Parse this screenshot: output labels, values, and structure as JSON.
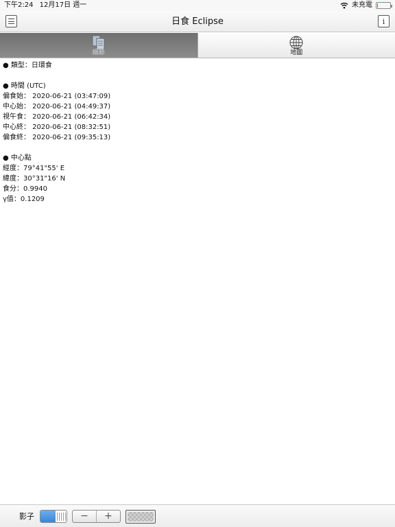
{
  "status_bar": {
    "time": "下午2:24",
    "date": "12月17日 週一",
    "charging": "未充電",
    "battery_level": 0.05
  },
  "nav": {
    "title": "日食 Eclipse",
    "left_icon": "menu-icon",
    "right_icon": "info-icon"
  },
  "tabs": [
    {
      "label": "細節",
      "icon": "documents-icon",
      "selected": true
    },
    {
      "label": "地圖",
      "icon": "globe-icon",
      "selected": false
    }
  ],
  "details": {
    "type_line": "● 類型：日環食",
    "times_header": "● 時間 (UTC)",
    "times": [
      "偏食始： 2020-06-21 (03:47:09)",
      "中心始： 2020-06-21 (04:49:37)",
      "視午食： 2020-06-21 (06:42:34)",
      "中心終： 2020-06-21 (08:32:51)",
      "偏食終： 2020-06-21 (09:35:13)"
    ],
    "center_header": "● 中心點",
    "center": [
      "經度：79°41\"55' E",
      "緯度：30°31\"16' N",
      "食分：0.9940",
      "γ值：0.1209"
    ]
  },
  "toolbar": {
    "shadow_label": "影子",
    "shadow_on": true,
    "minus": "−",
    "plus": "+"
  },
  "colors": {
    "toggle_on": "#3a86d6",
    "tab_selected": "#7a7a7a",
    "battery_low": "#e03a3a"
  }
}
